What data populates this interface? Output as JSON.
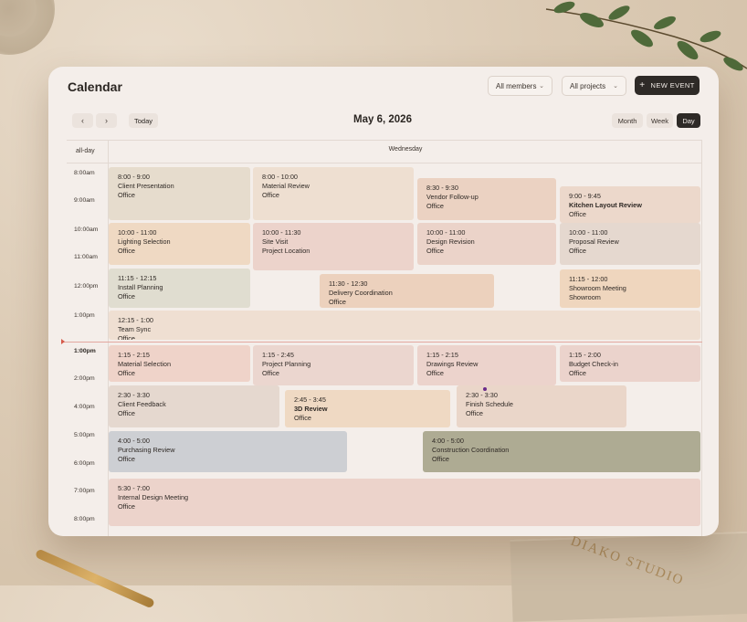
{
  "header": {
    "title": "Calendar",
    "members_filter": "All members",
    "projects_filter": "All projects",
    "new_event_label": "NEW EVENT"
  },
  "nav": {
    "prev_glyph": "‹",
    "next_glyph": "›",
    "today_label": "Today",
    "date_title": "May 6, 2026",
    "views": [
      "Month",
      "Week",
      "Day"
    ],
    "active_view": "Day"
  },
  "grid": {
    "allday_label": "all-day",
    "day_label": "Wednesday",
    "time_labels": [
      "8:00am",
      "9:00am",
      "10:00am",
      "11:00am",
      "12:00pm",
      "1:00pm",
      "1:00pm",
      "2:00pm",
      "4:00pm",
      "5:00pm",
      "6:00pm",
      "7:00pm",
      "8:00pm"
    ],
    "current_time_label": "1:00pm"
  },
  "events": [
    {
      "time": "8:00 - 9:00",
      "name": "Client Presentation",
      "location": "Office",
      "color": "#e6dccd"
    },
    {
      "time": "8:00 - 10:00",
      "name": "Material Review",
      "location": "Office",
      "color": "#eedfd1"
    },
    {
      "time": "8:30 - 9:30",
      "name": "Vendor Follow-up",
      "location": "Office",
      "color": "#ebd2c2"
    },
    {
      "time": "9:00 - 9:45",
      "name": "Kitchen Layout Review",
      "location": "Office",
      "color": "#ecd8cb"
    },
    {
      "time": "10:00 - 11:00",
      "name": "Lighting Selection",
      "location": "Office",
      "color": "#efd9c3"
    },
    {
      "time": "10:00 - 11:30",
      "name": "Site Visit",
      "location": "Project Location",
      "color": "#ecd3cb"
    },
    {
      "time": "10:00 - 11:00",
      "name": "Design Revision",
      "location": "Office",
      "color": "#ebd3c9"
    },
    {
      "time": "10:00 - 11:00",
      "name": "Proposal Review",
      "location": "Office",
      "color": "#e5d8cf"
    },
    {
      "time": "11:15 - 12:15",
      "name": "Install Planning",
      "location": "Office",
      "color": "#e0ddd0"
    },
    {
      "time": "11:30 - 12:30",
      "name": "Delivery Coordination",
      "location": "Office",
      "color": "#ecd1bd"
    },
    {
      "time": "11:15 - 12:00",
      "name": "Showroom Meeting",
      "location": "Showroom",
      "color": "#efd6be"
    },
    {
      "time": "12:15 - 1:00",
      "name": "Team Sync",
      "location": "Office",
      "color": "#efdfd2"
    },
    {
      "time": "1:15 - 2:15",
      "name": "Material Selection",
      "location": "Office",
      "color": "#efd3c9"
    },
    {
      "time": "1:15 - 2:45",
      "name": "Project Planning",
      "location": "Office",
      "color": "#ebd6cf"
    },
    {
      "time": "1:15 - 2:15",
      "name": "Drawings Review",
      "location": "Office",
      "color": "#ecd3cc"
    },
    {
      "time": "1:15 - 2:00",
      "name": "Budget Check-in",
      "location": "Office",
      "color": "#ebd3cc"
    },
    {
      "time": "2:30 - 3:30",
      "name": "Client Feedback",
      "location": "Office",
      "color": "#e5d8cf"
    },
    {
      "time": "2:45 - 3:45",
      "name": "3D Review",
      "location": "Office",
      "color": "#efd9c3"
    },
    {
      "time": "2:30 - 3:30",
      "name": "Finish Schedule",
      "location": "Office",
      "color": "#ead6c9"
    },
    {
      "time": "4:00 - 5:00",
      "name": "Purchasing Review",
      "location": "Office",
      "color": "#cdcfd3"
    },
    {
      "time": "4:00 - 5:00",
      "name": "Construction Coordination",
      "location": "Office",
      "color": "#aeab93"
    },
    {
      "time": "5:30 - 7:00",
      "name": "Internal Design Meeting",
      "location": "Office",
      "color": "#ecd3cb"
    }
  ],
  "book_title": "DIAKO STUDIO"
}
